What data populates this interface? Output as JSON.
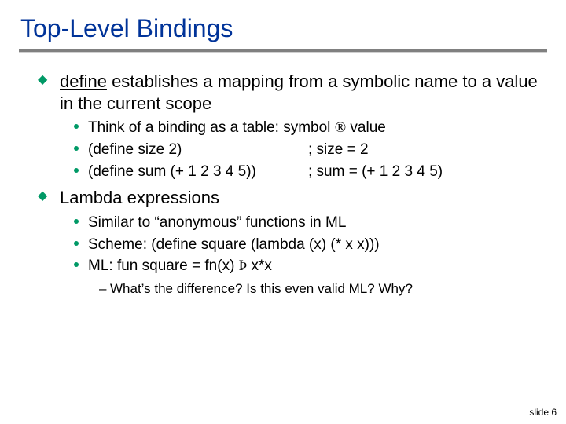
{
  "title": "Top-Level Bindings",
  "p1": {
    "key": "define",
    "rest": " establishes a mapping from a symbolic name to a value in the current scope",
    "s1a": "Think of a binding as a table: symbol ",
    "s1b": " value",
    "s2a": "(define size 2)",
    "s2b": ";  size = 2",
    "s3a": "(define sum (+ 1 2 3 4 5))",
    "s3b": ";  sum = (+ 1 2 3 4 5)"
  },
  "p2": {
    "head": "Lambda expressions",
    "s1": "Similar to “anonymous” functions in ML",
    "s2": "Scheme: (define square (lambda (x) (* x x)))",
    "s3a": "ML: fun square = fn(x) ",
    "s3b": " x*x",
    "q": "What’s the difference?  Is this even valid ML?  Why?"
  },
  "glyph": {
    "diamond": "◆",
    "arrow": "®",
    "darrow": "Þ",
    "dash": "–"
  },
  "footer": "slide 6"
}
